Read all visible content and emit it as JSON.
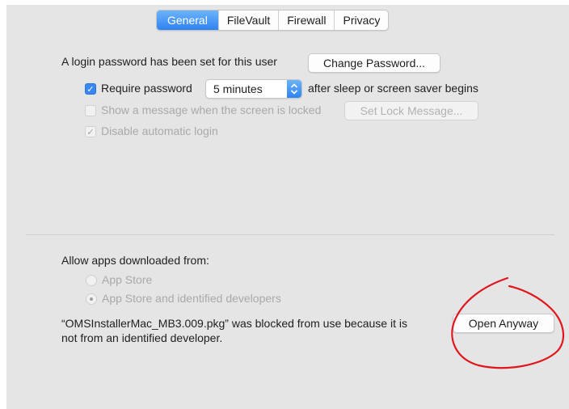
{
  "tabs": [
    {
      "label": "General",
      "active": true
    },
    {
      "label": "FileVault",
      "active": false
    },
    {
      "label": "Firewall",
      "active": false
    },
    {
      "label": "Privacy",
      "active": false
    }
  ],
  "login": {
    "message": "A login password has been set for this user",
    "change_password_label": "Change Password..."
  },
  "require_password": {
    "label": "Require password",
    "checked": true,
    "delay_value": "5 minutes",
    "suffix": "after sleep or screen saver begins"
  },
  "lock_message": {
    "label": "Show a message when the screen is locked",
    "checked": false,
    "button_label": "Set Lock Message..."
  },
  "auto_login": {
    "label": "Disable automatic login",
    "checked": true
  },
  "downloads": {
    "heading": "Allow apps downloaded from:",
    "options": [
      {
        "label": "App Store",
        "selected": false
      },
      {
        "label": "App Store and identified developers",
        "selected": true
      }
    ]
  },
  "blocked": {
    "line1": "“OMSInstallerMac_MB3.009.pkg” was blocked from use because it is",
    "line2": "not from an identified developer.",
    "open_anyway_label": "Open Anyway"
  },
  "colors": {
    "accent": "#2f83f2",
    "annotation": "#e0161c",
    "panel_bg": "#e5e5e5"
  }
}
